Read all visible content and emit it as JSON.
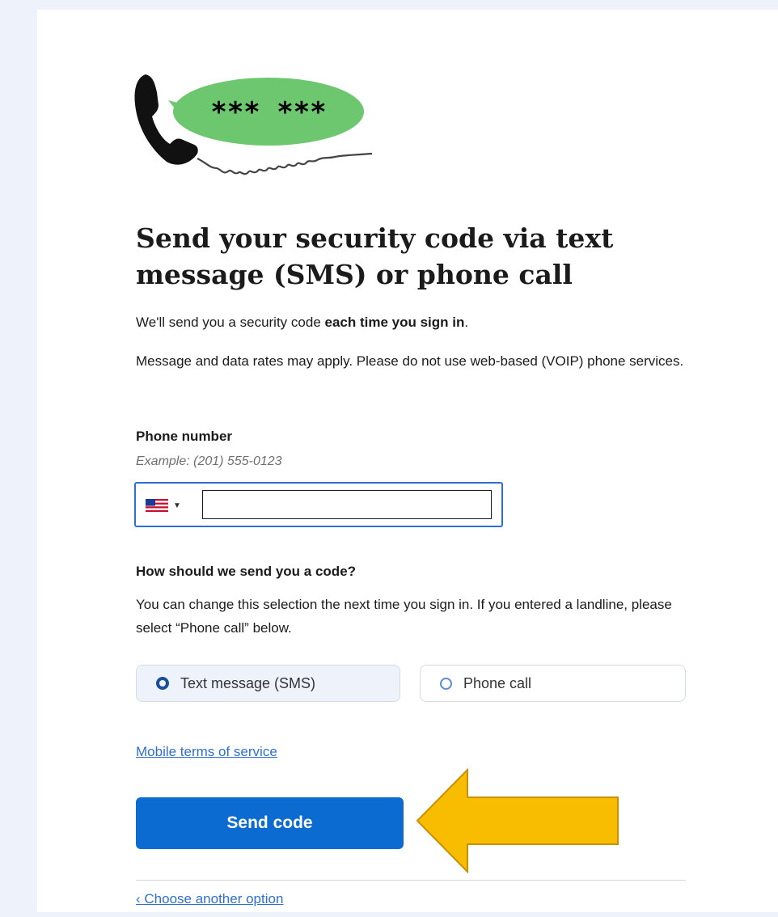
{
  "illustration": {
    "code_mask": "*** ***",
    "bubble_color": "#6cc76f",
    "handset_color": "#111111"
  },
  "title": "Send your security code via text message (SMS) or phone call",
  "intro": {
    "prefix": "We'll send you a security code ",
    "bold": "each time you sign in",
    "suffix": "."
  },
  "rates_notice": "Message and data rates may apply. Please do not use web-based (VOIP) phone services.",
  "phone": {
    "label": "Phone number",
    "hint": "Example: (201) 555-0123",
    "country_flag": "us-flag-icon",
    "value": ""
  },
  "method": {
    "heading": "How should we send you a code?",
    "description": "You can change this selection the next time you sign in. If you entered a landline, please select “Phone call” below.",
    "options": [
      {
        "label": "Text message (SMS)",
        "selected": true
      },
      {
        "label": "Phone call",
        "selected": false
      }
    ]
  },
  "links": {
    "terms": "Mobile terms of service",
    "back": "‹ Choose another option"
  },
  "send_button": "Send code",
  "colors": {
    "primary": "#0b6bd0",
    "link": "#2f6fd0",
    "arrow": "#f8bd00"
  }
}
